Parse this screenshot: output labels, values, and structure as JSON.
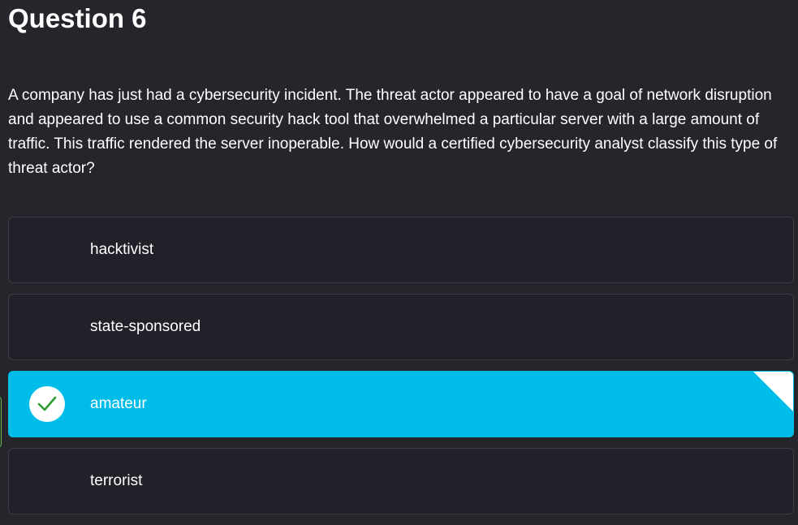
{
  "question": {
    "title": "Question 6",
    "text": "A company has just had a cybersecurity incident. The threat actor appeared to have a goal of network disruption and appeared to use a common security hack tool that overwhelmed a particular server with a large amount of traffic. This traffic rendered the server inoperable. How would a certified cybersecurity analyst classify this type of threat actor?"
  },
  "options": [
    {
      "label": "hacktivist",
      "selected": false
    },
    {
      "label": "state-sponsored",
      "selected": false
    },
    {
      "label": "amateur",
      "selected": true,
      "icon": "check-icon"
    },
    {
      "label": "terrorist",
      "selected": false
    }
  ],
  "colors": {
    "background": "#25262b",
    "option_background": "#212229",
    "selected_background": "#00bce8",
    "check_color": "#2e9a2e",
    "side_marker": "#5fbf4f"
  }
}
